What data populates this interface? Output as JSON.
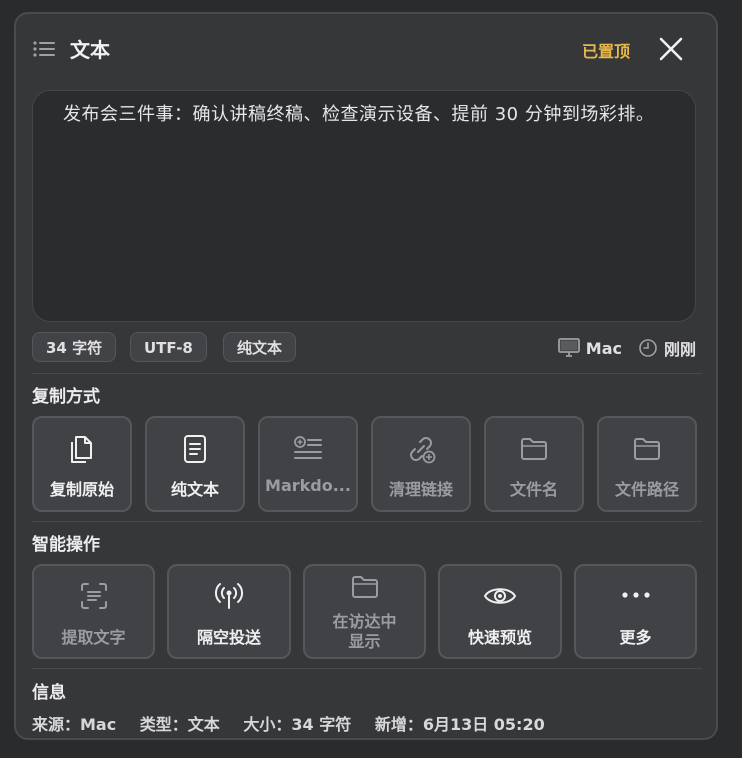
{
  "header": {
    "title": "文本",
    "pinned_label": "已置顶"
  },
  "editor": {
    "content": "发布会三件事：确认讲稿终稿、检查演示设备、提前 30 分钟到场彩排。"
  },
  "meta": {
    "chips": [
      "34 字符",
      "UTF-8",
      "纯文本"
    ],
    "device": "Mac",
    "time": "刚刚"
  },
  "copy_section": {
    "label": "复制方式",
    "items": [
      {
        "label": "复制原始",
        "icon": "copy-icon",
        "enabled": true
      },
      {
        "label": "纯文本",
        "icon": "document-icon",
        "enabled": true
      },
      {
        "label": "Markdo...",
        "icon": "markdown-list-icon",
        "enabled": false
      },
      {
        "label": "清理链接",
        "icon": "link-clean-icon",
        "enabled": false
      },
      {
        "label": "文件名",
        "icon": "folder-icon",
        "enabled": false
      },
      {
        "label": "文件路径",
        "icon": "folder-icon",
        "enabled": false
      }
    ]
  },
  "smart_section": {
    "label": "智能操作",
    "items": [
      {
        "label": "提取文字",
        "icon": "text-scan-icon",
        "enabled": false
      },
      {
        "label": "隔空投送",
        "icon": "airdrop-icon",
        "enabled": true
      },
      {
        "label": "在访达中显示",
        "icon": "folder-icon",
        "enabled": false
      },
      {
        "label": "快速预览",
        "icon": "eye-icon",
        "enabled": true
      },
      {
        "label": "更多",
        "icon": "more-icon",
        "enabled": true
      }
    ]
  },
  "info_section": {
    "label": "信息",
    "source": "来源：Mac",
    "type": "类型：文本",
    "size": "大小：34 字符",
    "added": "新增：6月13日 05:20"
  },
  "colors": {
    "accent_pinned": "#e8b84a",
    "panel_bg": "#363739",
    "tile_bg": "#414246"
  }
}
